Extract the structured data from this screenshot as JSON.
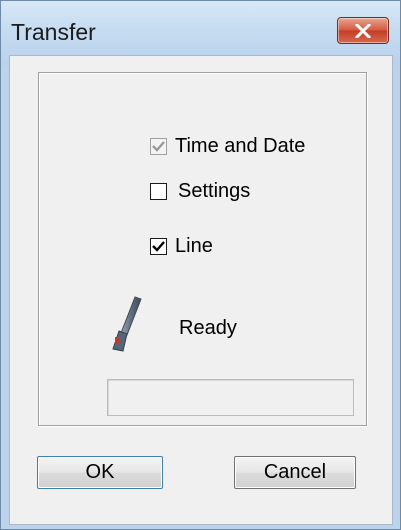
{
  "window": {
    "title": "Transfer"
  },
  "options": [
    {
      "label": "Time and Date",
      "checked": true,
      "enabled": false
    },
    {
      "label": "Settings",
      "checked": false,
      "enabled": true
    },
    {
      "label": "Line",
      "checked": true,
      "enabled": true
    }
  ],
  "status": {
    "icon": "cable-icon",
    "text": "Ready",
    "progress": 0
  },
  "buttons": {
    "ok": "OK",
    "cancel": "Cancel"
  },
  "colors": {
    "close_button": "#d6573f",
    "window_frame": "#bcd3ea",
    "client_background": "#f0f0f0"
  }
}
